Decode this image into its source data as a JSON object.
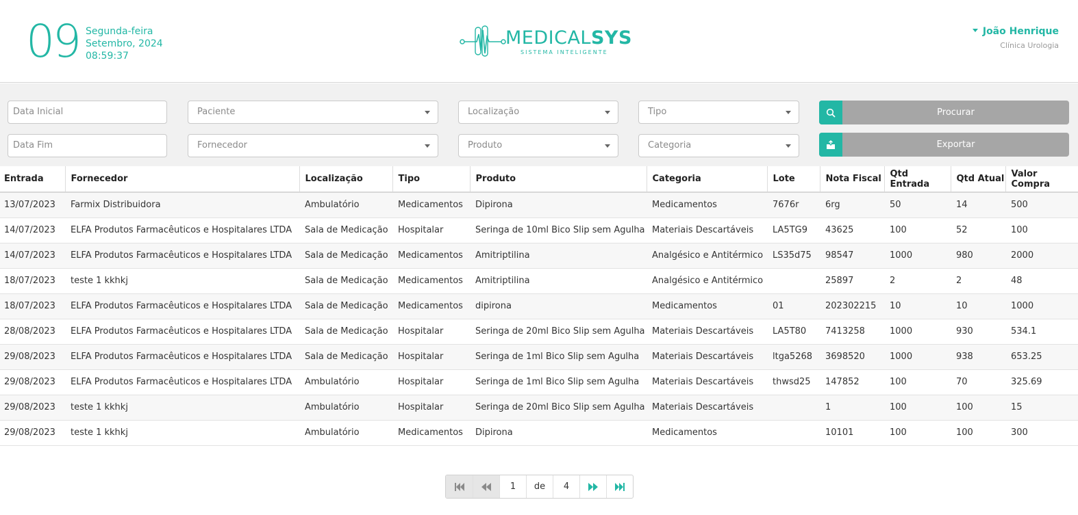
{
  "header": {
    "day": "09",
    "weekday": "Segunda-feira",
    "month_year": "Setembro, 2024",
    "time": "08:59:37",
    "logo_main_light": "MEDICAL",
    "logo_main_bold": "SYS",
    "logo_sub": "SISTEMA INTELIGENTE",
    "user_name": "João Henrique",
    "user_clinic": "Clínica Urologia"
  },
  "filters": {
    "data_inicial": "Data Inicial",
    "data_fim": "Data Fim",
    "paciente": "Paciente",
    "fornecedor": "Fornecedor",
    "localizacao": "Localização",
    "produto": "Produto",
    "tipo": "Tipo",
    "categoria": "Categoria",
    "procurar": "Procurar",
    "exportar": "Exportar"
  },
  "table": {
    "headers": [
      "Entrada",
      "Fornecedor",
      "Localização",
      "Tipo",
      "Produto",
      "Categoria",
      "Lote",
      "Nota Fiscal",
      "Qtd Entrada",
      "Qtd Atual",
      "Valor Compra"
    ],
    "rows": [
      [
        "13/07/2023",
        "Farmix Distribuidora",
        "Ambulatório",
        "Medicamentos",
        "Dipirona",
        "Medicamentos",
        "7676r",
        "6rg",
        "50",
        "14",
        "500"
      ],
      [
        "14/07/2023",
        "ELFA Produtos Farmacêuticos e Hospitalares LTDA",
        "Sala de Medicação",
        "Hospitalar",
        "Seringa de 10ml Bico Slip sem Agulha",
        "Materiais Descartáveis",
        "LA5TG9",
        "43625",
        "100",
        "52",
        "100"
      ],
      [
        "14/07/2023",
        "ELFA Produtos Farmacêuticos e Hospitalares LTDA",
        "Sala de Medicação",
        "Medicamentos",
        "Amitriptilina",
        "Analgésico e Antitérmico",
        "LS35d75",
        "98547",
        "1000",
        "980",
        "2000"
      ],
      [
        "18/07/2023",
        "teste 1 kkhkj",
        "Sala de Medicação",
        "Medicamentos",
        "Amitriptilina",
        "Analgésico e Antitérmico",
        "",
        "25897",
        "2",
        "2",
        "48"
      ],
      [
        "18/07/2023",
        "ELFA Produtos Farmacêuticos e Hospitalares LTDA",
        "Sala de Medicação",
        "Medicamentos",
        "dipirona",
        "Medicamentos",
        "01",
        "202302215",
        "10",
        "10",
        "1000"
      ],
      [
        "28/08/2023",
        "ELFA Produtos Farmacêuticos e Hospitalares LTDA",
        "Sala de Medicação",
        "Hospitalar",
        "Seringa de 20ml Bico Slip sem Agulha",
        "Materiais Descartáveis",
        "LA5T80",
        "7413258",
        "1000",
        "930",
        "534.1"
      ],
      [
        "29/08/2023",
        "ELFA Produtos Farmacêuticos e Hospitalares LTDA",
        "Sala de Medicação",
        "Hospitalar",
        "Seringa de 1ml Bico Slip sem Agulha",
        "Materiais Descartáveis",
        "ltga5268",
        "3698520",
        "1000",
        "938",
        "653.25"
      ],
      [
        "29/08/2023",
        "ELFA Produtos Farmacêuticos e Hospitalares LTDA",
        "Ambulatório",
        "Hospitalar",
        "Seringa de 1ml Bico Slip sem Agulha",
        "Materiais Descartáveis",
        "thwsd25",
        "147852",
        "100",
        "70",
        "325.69"
      ],
      [
        "29/08/2023",
        "teste 1 kkhkj",
        "Ambulatório",
        "Hospitalar",
        "Seringa de 20ml Bico Slip sem Agulha",
        "Materiais Descartáveis",
        "",
        "1",
        "100",
        "100",
        "15"
      ],
      [
        "29/08/2023",
        "teste 1 kkhkj",
        "Ambulatório",
        "Medicamentos",
        "Dipirona",
        "Medicamentos",
        "",
        "10101",
        "100",
        "100",
        "300"
      ]
    ]
  },
  "pagination": {
    "current_page": "1",
    "of_label": "de",
    "total_pages": "4"
  },
  "colors": {
    "accent": "#23b7a5",
    "button_gray": "#a6a6a6",
    "filter_bg": "#f1f1f1"
  },
  "icons": {
    "search": "search-icon",
    "export": "export-icon",
    "first": "first-page-icon",
    "prev": "prev-page-icon",
    "next": "next-page-icon",
    "last": "last-page-icon",
    "user_caret": "caret-down-icon"
  }
}
